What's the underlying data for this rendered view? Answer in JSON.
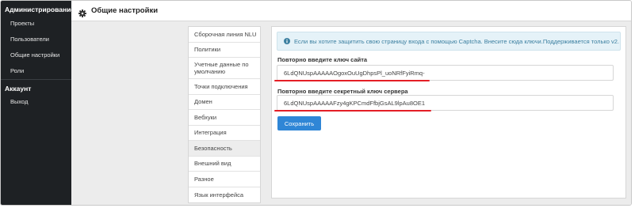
{
  "sidebar": {
    "sections": [
      {
        "title": "Администрирование",
        "items": [
          "Проекты",
          "Пользователи",
          "Общие настройки",
          "Роли"
        ]
      },
      {
        "title": "Аккаунт",
        "items": [
          "Выход"
        ]
      }
    ]
  },
  "header": {
    "title": "Общие настройки",
    "icon": "gear-icon"
  },
  "menu": {
    "items": [
      "Сборочная линия NLU",
      "Политики",
      "Учетные данные по умолчанию",
      "Точки подключения",
      "Домен",
      "Вебхуки",
      "Интеграция",
      "Безопасность",
      "Внешний вид",
      "Разное",
      "Язык интерфейса"
    ],
    "active": "Безопасность"
  },
  "security": {
    "alert_text": "Если вы хотите защитить свою страницу входа с помощью Captcha.",
    "alert_link": "Внесите сюда ключи.",
    "alert_suffix": "Поддерживается только v2.",
    "site_key_label": "Повторно введите ключ сайта",
    "site_key_value": "6LdQNUspAAAAAOgoxOuUgDhpsPl_uoNRfFyiRmq-",
    "secret_key_label": "Повторно введите секретный ключ сервера",
    "secret_key_value": "6LdQNUspAAAAAFzy4gKPCmdFfbjGsAL9lpAu8OE1",
    "save_label": "Сохранить"
  },
  "colors": {
    "sidebar_bg": "#1e2124",
    "accent": "#2f86d6",
    "alert_bg": "#e5f2f8",
    "highlight": "#e41e26"
  }
}
